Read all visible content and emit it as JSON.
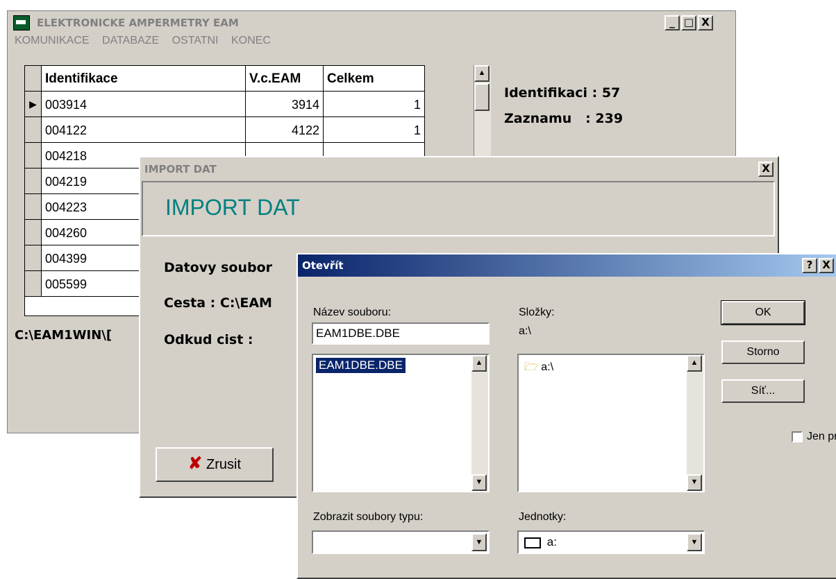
{
  "main_window": {
    "title": "ELEKTRONICKE AMPERMETRY EAM",
    "menu": [
      "KOMUNIKACE",
      "DATABAZE",
      "OSTATNI",
      "KONEC"
    ],
    "table": {
      "columns": [
        "Identifikace",
        "V.c.EAM",
        "Celkem"
      ],
      "rows": [
        {
          "id": "003914",
          "vc": "3914",
          "celkem": "1",
          "current": true
        },
        {
          "id": "004122",
          "vc": "4122",
          "celkem": "1"
        },
        {
          "id": "004218",
          "vc": "",
          "celkem": ""
        },
        {
          "id": "004219",
          "vc": "",
          "celkem": ""
        },
        {
          "id": "004223",
          "vc": "",
          "celkem": ""
        },
        {
          "id": "004260",
          "vc": "",
          "celkem": ""
        },
        {
          "id": "004399",
          "vc": "",
          "celkem": ""
        },
        {
          "id": "005599",
          "vc": "",
          "celkem": ""
        }
      ]
    },
    "stats": {
      "identifikaci": "Identifikaci : 57",
      "zaznamu": "Zaznamu   : 239"
    },
    "path": "C:\\EAM1WIN\\[",
    "window_buttons": [
      "_",
      "□",
      "X"
    ]
  },
  "import_dialog": {
    "title": "IMPORT DAT",
    "heading": "IMPORT DAT",
    "label_file": "Datovy soubor",
    "label_path": "Cesta :  C:\\EAM",
    "label_from": "Odkud cist :",
    "cancel_label": "Zrusit",
    "cancel_icon": "x-icon",
    "close_glyph": "X"
  },
  "open_dialog": {
    "title": "Otevřít",
    "help_glyph": "?",
    "close_glyph": "X",
    "file_name_label": "Název souboru:",
    "file_name_value": "EAM1DBE.DBE",
    "files": [
      "EAM1DBE.DBE"
    ],
    "folders_label": "Složky:",
    "current_folder": "a:\\",
    "folder_items": [
      "a:\\"
    ],
    "ok_label": "OK",
    "cancel_label": "Storno",
    "network_label": "Síť...",
    "readonly_label": "Jen pro čtení",
    "file_type_label": "Zobrazit soubory typu:",
    "file_type_value": "",
    "drives_label": "Jednotky:",
    "drive_value": "a:"
  },
  "colors": {
    "window_bg": "#d4d0c8",
    "active_title_start": "#0a246a",
    "active_title_end": "#a6caf0",
    "heading_teal": "#008080",
    "selection": "#0a246a",
    "cancel_icon_red": "#c00000"
  }
}
